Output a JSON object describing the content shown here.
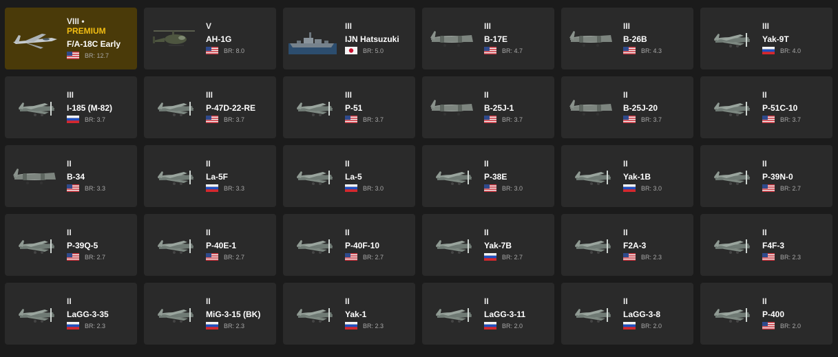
{
  "vehicles": [
    {
      "rank": "VIII •",
      "premium_label": "PREMIUM",
      "name": "F/A-18C Early",
      "country": "usa",
      "br": "BR: 12.7",
      "premium": true,
      "icon": "jet-aircraft-icon"
    },
    {
      "rank": "V",
      "name": "AH-1G",
      "country": "usa",
      "br": "BR: 8.0",
      "icon": "helicopter-icon"
    },
    {
      "rank": "III",
      "name": "IJN Hatsuzuki",
      "country": "japan",
      "br": "BR: 5.0",
      "icon": "destroyer-ship-icon"
    },
    {
      "rank": "III",
      "name": "B-17E",
      "country": "usa",
      "br": "BR: 4.7",
      "icon": "bomber-aircraft-icon"
    },
    {
      "rank": "III",
      "name": "B-26B",
      "country": "usa",
      "br": "BR: 4.3",
      "icon": "bomber-aircraft-icon"
    },
    {
      "rank": "III",
      "name": "Yak-9T",
      "country": "russia",
      "br": "BR: 4.0",
      "icon": "fighter-aircraft-icon"
    },
    {
      "rank": "III",
      "name": "I-185 (M-82)",
      "country": "russia",
      "br": "BR: 3.7",
      "icon": "fighter-aircraft-icon"
    },
    {
      "rank": "III",
      "name": "P-47D-22-RE",
      "country": "usa",
      "br": "BR: 3.7",
      "icon": "fighter-aircraft-icon"
    },
    {
      "rank": "III",
      "name": "P-51",
      "country": "usa",
      "br": "BR: 3.7",
      "icon": "fighter-aircraft-icon"
    },
    {
      "rank": "II",
      "name": "B-25J-1",
      "country": "usa",
      "br": "BR: 3.7",
      "icon": "bomber-aircraft-icon"
    },
    {
      "rank": "II",
      "name": "B-25J-20",
      "country": "usa",
      "br": "BR: 3.7",
      "icon": "bomber-aircraft-icon"
    },
    {
      "rank": "II",
      "name": "P-51C-10",
      "country": "usa",
      "br": "BR: 3.7",
      "icon": "fighter-aircraft-icon"
    },
    {
      "rank": "II",
      "name": "B-34",
      "country": "usa",
      "br": "BR: 3.3",
      "icon": "bomber-aircraft-icon"
    },
    {
      "rank": "II",
      "name": "La-5F",
      "country": "russia",
      "br": "BR: 3.3",
      "icon": "fighter-aircraft-icon"
    },
    {
      "rank": "II",
      "name": "La-5",
      "country": "russia",
      "br": "BR: 3.0",
      "icon": "fighter-aircraft-icon"
    },
    {
      "rank": "II",
      "name": "P-38E",
      "country": "usa",
      "br": "BR: 3.0",
      "icon": "fighter-aircraft-icon"
    },
    {
      "rank": "II",
      "name": "Yak-1B",
      "country": "russia",
      "br": "BR: 3.0",
      "icon": "fighter-aircraft-icon"
    },
    {
      "rank": "II",
      "name": "P-39N-0",
      "country": "usa",
      "br": "BR: 2.7",
      "icon": "fighter-aircraft-icon"
    },
    {
      "rank": "II",
      "name": "P-39Q-5",
      "country": "usa",
      "br": "BR: 2.7",
      "icon": "fighter-aircraft-icon"
    },
    {
      "rank": "II",
      "name": "P-40E-1",
      "country": "usa",
      "br": "BR: 2.7",
      "icon": "fighter-aircraft-icon"
    },
    {
      "rank": "II",
      "name": "P-40F-10",
      "country": "usa",
      "br": "BR: 2.7",
      "icon": "fighter-aircraft-icon"
    },
    {
      "rank": "II",
      "name": "Yak-7B",
      "country": "russia",
      "br": "BR: 2.7",
      "icon": "fighter-aircraft-icon"
    },
    {
      "rank": "II",
      "name": "F2A-3",
      "country": "usa",
      "br": "BR: 2.3",
      "icon": "fighter-aircraft-icon"
    },
    {
      "rank": "II",
      "name": "F4F-3",
      "country": "usa",
      "br": "BR: 2.3",
      "icon": "fighter-aircraft-icon"
    },
    {
      "rank": "II",
      "name": "LaGG-3-35",
      "country": "russia",
      "br": "BR: 2.3",
      "icon": "fighter-aircraft-icon"
    },
    {
      "rank": "II",
      "name": "MiG-3-15 (BK)",
      "country": "russia",
      "br": "BR: 2.3",
      "icon": "fighter-aircraft-icon"
    },
    {
      "rank": "II",
      "name": "Yak-1",
      "country": "russia",
      "br": "BR: 2.3",
      "icon": "fighter-aircraft-icon"
    },
    {
      "rank": "II",
      "name": "LaGG-3-11",
      "country": "russia",
      "br": "BR: 2.0",
      "icon": "fighter-aircraft-icon"
    },
    {
      "rank": "II",
      "name": "LaGG-3-8",
      "country": "russia",
      "br": "BR: 2.0",
      "icon": "fighter-aircraft-icon"
    },
    {
      "rank": "II",
      "name": "P-400",
      "country": "usa",
      "br": "BR: 2.0",
      "icon": "fighter-aircraft-icon"
    }
  ],
  "colors": {
    "background": "#1b1b1b",
    "card": "#2a2a2a",
    "premium_card": "#4a3a09",
    "premium_text": "#f2bd12",
    "br_text": "#a8a8a8"
  }
}
